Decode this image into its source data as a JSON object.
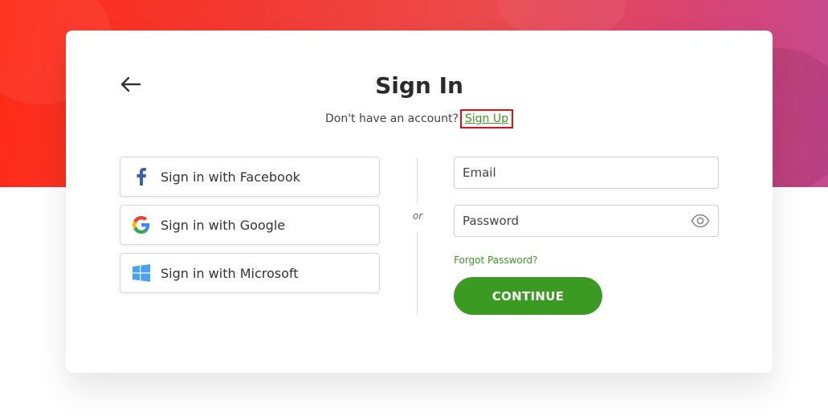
{
  "page": {
    "title": "Sign In",
    "subtitle_text": "Don't have an account?",
    "signup_link": "Sign Up"
  },
  "social": [
    {
      "label": "Sign in with Facebook",
      "icon": "facebook-icon"
    },
    {
      "label": "Sign in with Google",
      "icon": "google-icon"
    },
    {
      "label": "Sign in with Microsoft",
      "icon": "microsoft-icon"
    }
  ],
  "divider_text": "or",
  "form": {
    "email_placeholder": "Email",
    "password_placeholder": "Password",
    "forgot_label": "Forgot Password?",
    "continue_label": "CONTINUE"
  },
  "colors": {
    "accent": "#3a9a22",
    "hero_start": "#ff2a16",
    "hero_end": "#c44a90",
    "highlight_box": "#e01010"
  }
}
